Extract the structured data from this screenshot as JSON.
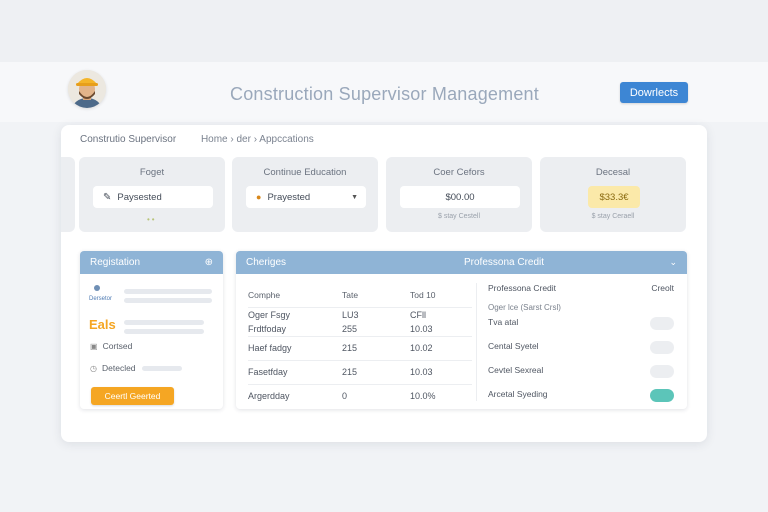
{
  "header": {
    "title": "Construction Supervisor Management",
    "button_label": "Dowrlects"
  },
  "breadcrumb": {
    "root": "Construtio Supervisor",
    "path": "Home  ›  der  ›  Appccations"
  },
  "stats": [
    {
      "title": "Foget",
      "value": "Paysested",
      "icon": "pencil-icon",
      "sub": ""
    },
    {
      "title": "Continue Education",
      "value": "Prayested",
      "icon": "status-dot-icon",
      "sub": ""
    },
    {
      "title": "Coer Cefors",
      "value": "$00.00",
      "sub": "$ stay Cestell"
    },
    {
      "title": "Decesal",
      "value": "$33.3€",
      "sub": "$ stay Ceraell"
    }
  ],
  "registration": {
    "title": "Registation",
    "item_label": "Dersetor",
    "brand": "Eals",
    "row1": "Cortsed",
    "row2": "Detecled",
    "button": "Ceertl Geerted"
  },
  "changes": {
    "title": "Cheriges",
    "columns": [
      "Comphe",
      "Tate",
      "Tod 10"
    ],
    "rows": [
      [
        "Oger Fsgy",
        "LU3",
        "CFll"
      ],
      [
        "Frdtfoday",
        "255",
        "10.03"
      ],
      [
        "Haef fadgy",
        "215",
        "10.02"
      ],
      [
        "Fasetfday",
        "215",
        "10.03"
      ],
      [
        "Argerdday",
        "0",
        "10.0%"
      ]
    ]
  },
  "credit": {
    "title": "Professona Credit",
    "col_left": "Professona Credit",
    "col_right": "Creolt",
    "subtitle": "Oger lce (Sarst Crsl)",
    "rows": [
      {
        "label": "Tva atal",
        "on": false
      },
      {
        "label": "Cental Syetel",
        "on": false
      },
      {
        "label": "Cevtel Sexreal",
        "on": false
      },
      {
        "label": "Arcetal Syeding",
        "on": true
      }
    ]
  },
  "colors": {
    "accent_blue": "#3d86d4",
    "panel_header": "#8fb4d6",
    "orange": "#f5a623",
    "toggle_on": "#5cc5b9",
    "highlight_yellow": "#fbe9a9"
  }
}
